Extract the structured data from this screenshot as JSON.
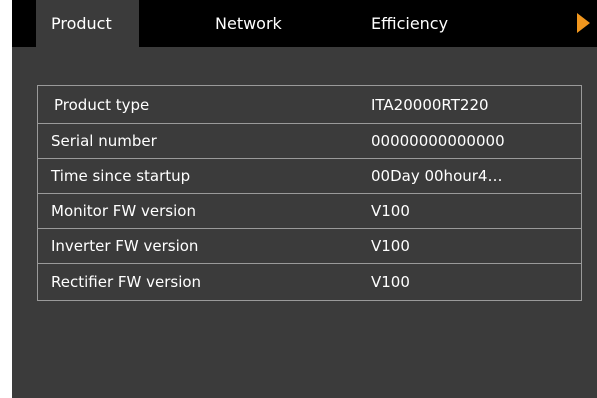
{
  "tabs": [
    {
      "label": "Product",
      "active": true
    },
    {
      "label": "Network",
      "active": false
    },
    {
      "label": "Efficiency",
      "active": false
    }
  ],
  "next_icon": "triangle-right-icon",
  "colors": {
    "background": "#3b3b3b",
    "tabbar": "#000000",
    "accent": "#f0961e",
    "border": "#9a9a9a",
    "text": "#ffffff"
  },
  "product_info": {
    "rows": [
      {
        "label": "Product type",
        "value": "ITA20000RT220"
      },
      {
        "label": "Serial number",
        "value": "00000000000000"
      },
      {
        "label": "Time since startup",
        "value": "00Day 00hour4…"
      },
      {
        "label": "Monitor FW version",
        "value": "V100"
      },
      {
        "label": "Inverter FW version",
        "value": "V100"
      },
      {
        "label": "Rectifier FW version",
        "value": "V100"
      }
    ]
  }
}
